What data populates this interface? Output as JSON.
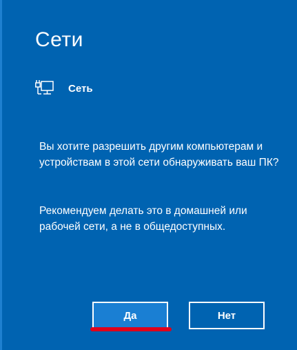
{
  "panel": {
    "title": "Сети",
    "network": {
      "icon": "ethernet-network-icon",
      "label": "Сеть"
    },
    "question": "Вы хотите разрешить другим компьютерам и устройствам в этой сети обнаруживать ваш ПК?",
    "recommendation": "Рекомендуем делать это в домашней или рабочей сети, а не в общедоступных.",
    "buttons": {
      "yes": "Да",
      "no": "Нет"
    },
    "colors": {
      "background": "#0063b1",
      "primary_button": "#1a7fd3",
      "highlight_underline": "#e0001a"
    }
  }
}
